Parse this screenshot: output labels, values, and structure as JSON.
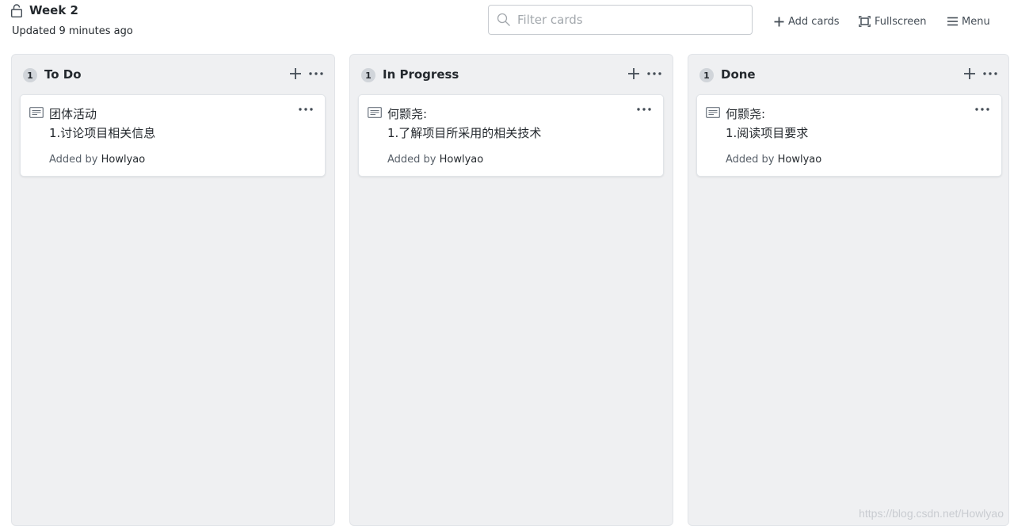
{
  "header": {
    "board_title": "Week 2",
    "updated_text": "Updated 9 minutes ago",
    "filter_placeholder": "Filter cards",
    "filter_value": "",
    "add_cards_label": "Add cards",
    "fullscreen_label": "Fullscreen",
    "menu_label": "Menu",
    "icons": [
      "lock-icon",
      "search-icon",
      "plus-icon",
      "fullscreen-icon",
      "menu-icon"
    ]
  },
  "columns": [
    {
      "count": "1",
      "title": "To Do",
      "cards": [
        {
          "text": "团体活动\n1.讨论项目相关信息",
          "added_prefix": "Added by",
          "author": "Howlyao"
        }
      ]
    },
    {
      "count": "1",
      "title": "In Progress",
      "cards": [
        {
          "text": "何颢尧:\n1.了解项目所采用的相关技术",
          "added_prefix": "Added by",
          "author": "Howlyao"
        }
      ]
    },
    {
      "count": "1",
      "title": "Done",
      "cards": [
        {
          "text": "何颢尧:\n1.阅读项目要求",
          "added_prefix": "Added by",
          "author": "Howlyao"
        }
      ]
    }
  ],
  "watermark": "https://blog.csdn.net/Howlyao",
  "colors": {
    "column_bg": "#eff0f2",
    "card_bg": "#ffffff",
    "text": "#24292e",
    "muted": "#586069",
    "badge_bg": "#d1d5da"
  }
}
